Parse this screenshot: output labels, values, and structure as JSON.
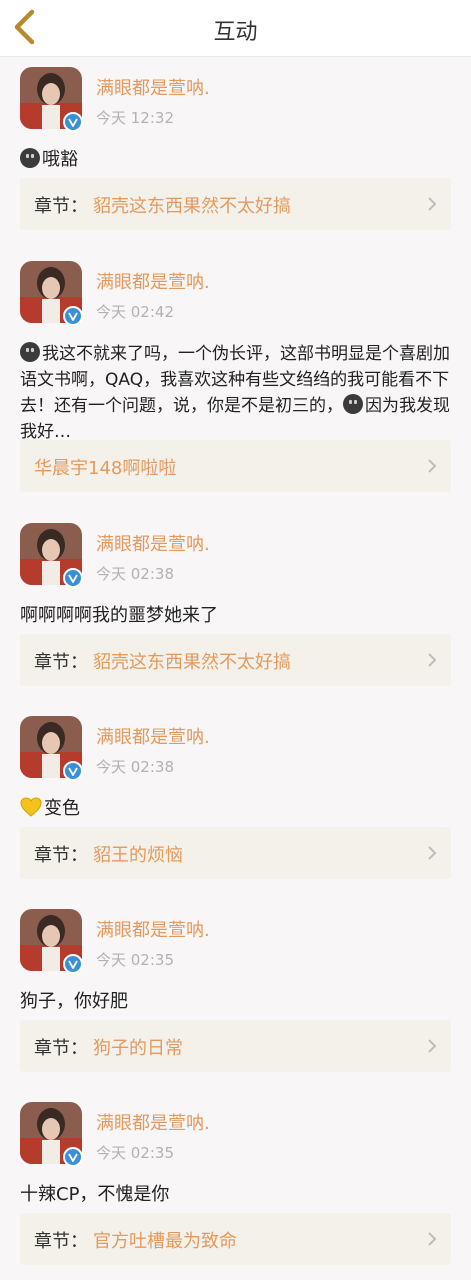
{
  "header": {
    "title": "互动",
    "back_icon": "chevron-left-icon",
    "back_color": "#b98a2d"
  },
  "colors": {
    "accent": "#e49a5e",
    "verified": "#3b8fd6",
    "chapter_bg": "#f3f1ea",
    "page_bg": "#f8f6f6"
  },
  "items": [
    {
      "username": "满眼都是萱呐.",
      "time": "今天 12:32",
      "emoji": "dark-face-emoji",
      "text": "哦豁",
      "chapter_label": "章节：",
      "chapter_value": "貂壳这东西果然不太好搞"
    },
    {
      "username": "满眼都是萱呐.",
      "time": "今天 02:42",
      "emoji": "dark-face-emoji",
      "text": "我这不就来了吗，一个伪长评，这部书明显是个喜剧加语文书啊，QAQ，我喜欢这种有些文绉绉的我可能看不下去！还有一个问题，说，你是不是初三的，",
      "emoji2": "dark-face-emoji",
      "text2": "因为我发现我好…",
      "chapter_label": "",
      "chapter_value": "华晨宇148啊啦啦"
    },
    {
      "username": "满眼都是萱呐.",
      "time": "今天 02:38",
      "text": "啊啊啊啊我的噩梦她来了",
      "chapter_label": "章节：",
      "chapter_value": "貂壳这东西果然不太好搞"
    },
    {
      "username": "满眼都是萱呐.",
      "time": "今天 02:38",
      "emoji": "yellow-heart-emoji",
      "text": "变色",
      "chapter_label": "章节：",
      "chapter_value": "貂王的烦恼"
    },
    {
      "username": "满眼都是萱呐.",
      "time": "今天 02:35",
      "text": "狗子，你好肥",
      "chapter_label": "章节：",
      "chapter_value": "狗子的日常"
    },
    {
      "username": "满眼都是萱呐.",
      "time": "今天 02:35",
      "text": "十辣CP，不愧是你",
      "chapter_label": "章节：",
      "chapter_value": "官方吐槽最为致命"
    }
  ]
}
